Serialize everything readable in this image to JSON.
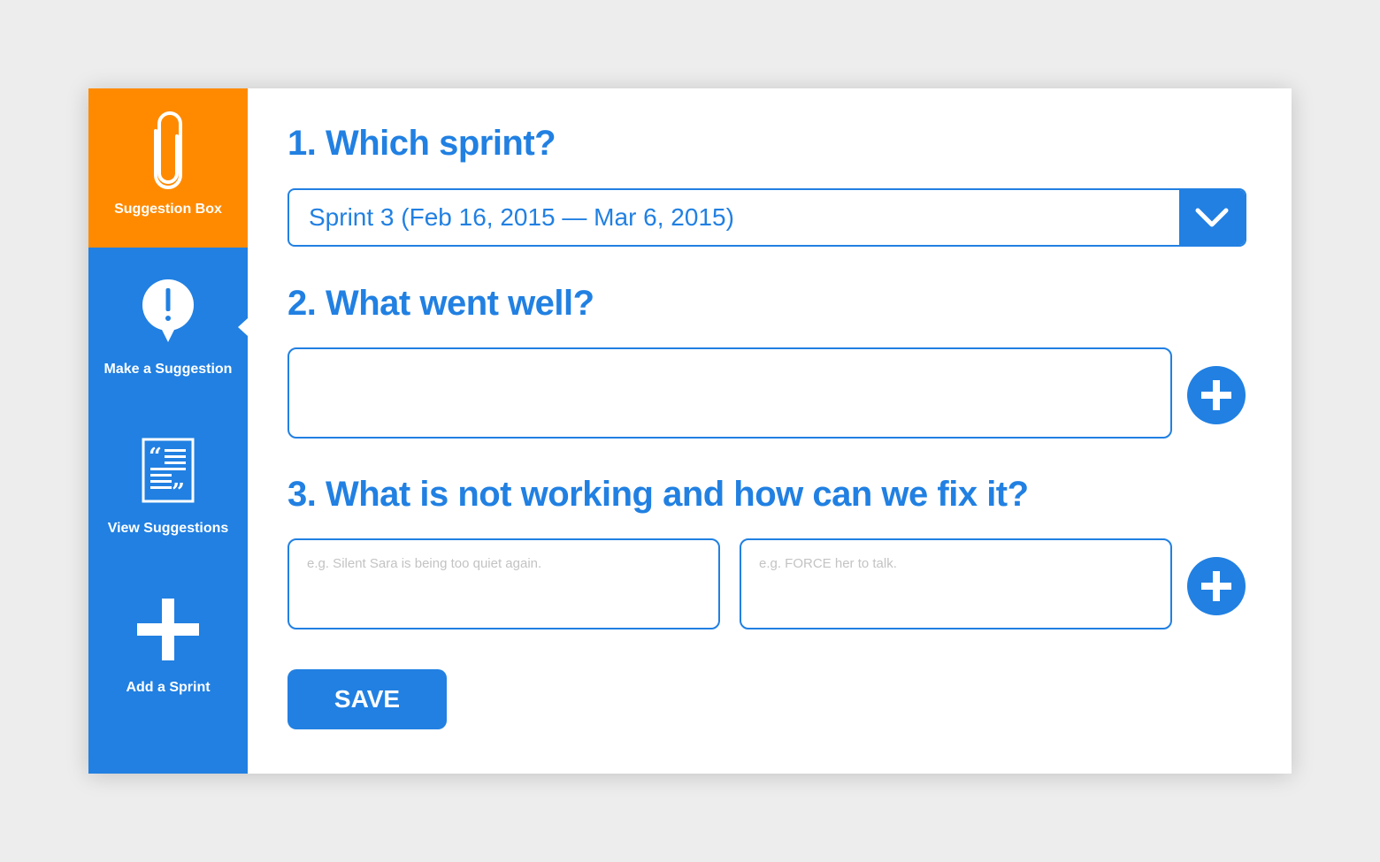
{
  "sidebar": {
    "brand_label": "Suggestion Box",
    "brand_icon": "paperclip-icon",
    "items": [
      {
        "label": "Make a Suggestion",
        "icon": "exclamation-bubble-icon",
        "active": true
      },
      {
        "label": "View Suggestions",
        "icon": "quote-document-icon",
        "active": false
      },
      {
        "label": "Add a Sprint",
        "icon": "plus-icon",
        "active": false
      }
    ]
  },
  "form": {
    "q1": {
      "title": "1. Which sprint?",
      "selected": "Sprint 3 (Feb 16, 2015 — Mar 6, 2015)"
    },
    "q2": {
      "title": "2. What went well?",
      "value": ""
    },
    "q3": {
      "title": "3. What is not working and how can we fix it?",
      "problem_placeholder": "e.g. Silent Sara is being too quiet again.",
      "fix_placeholder": "e.g. FORCE her to talk."
    },
    "save_label": "SAVE"
  },
  "colors": {
    "primary": "#2180e2",
    "brand": "#ff8a00",
    "background": "#ededed"
  }
}
